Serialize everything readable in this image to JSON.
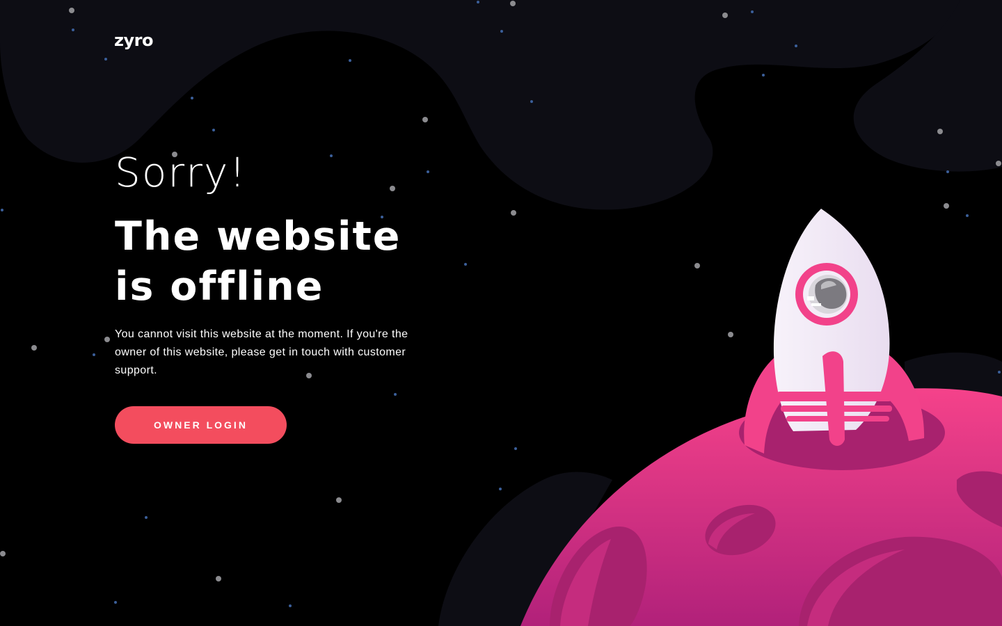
{
  "brand": {
    "logo_text": "zyro"
  },
  "main": {
    "greeting": "Sorry!",
    "headline": "The website is offline",
    "description": "You cannot visit this website at the moment. If you're the owner of this website, please get in touch with customer support.",
    "owner_login_label": "OWNER LOGIN"
  },
  "illustration": {
    "icons": [
      "rocket-icon",
      "astronaut-icon",
      "planet-icon",
      "star-icon",
      "nebula-cloud"
    ]
  },
  "colors": {
    "background": "#000000",
    "cloud": "#0d0d14",
    "button": "#f34d5e",
    "planet_top": "#f0407f",
    "planet_bottom": "#b5227a",
    "rocket_body": "#f4ecf7",
    "rocket_accent": "#f0407f"
  }
}
